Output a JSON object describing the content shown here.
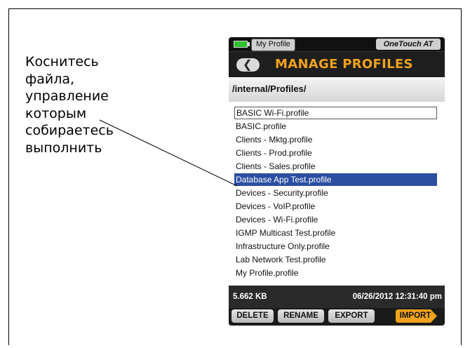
{
  "caption": {
    "lines": [
      "Коснитесь",
      "файла,",
      "управление",
      "которым",
      "собираетесь",
      "выполнить"
    ]
  },
  "device": {
    "status": {
      "profile_tab": "My Profile",
      "device_name": "OneTouch AT",
      "battery_color": "#2fbf2f"
    },
    "header": {
      "back_icon": "back-arrow-icon",
      "title": "MANAGE PROFILES",
      "title_color": "#f0a21c"
    },
    "path": "/internal/Profiles/",
    "files": [
      "BASIC Wi-Fi.profile",
      "BASIC.profile",
      "Clients - Mktg.profile",
      "Clients - Prod.profile",
      "Clients - Sales.profile",
      "Database App Test.profile",
      "Devices - Security.profile",
      "Devices - VoIP.profile",
      "Devices - Wi-Fi.profile",
      "IGMP Multicast Test.profile",
      "Infrastructure Only.profile",
      "Lab Network Test.profile",
      "My Profile.profile"
    ],
    "selected_file": "Database App Test.profile",
    "selection_color": "#2b4ea0",
    "info": {
      "size": "5.662 KB",
      "timestamp": "06/26/2012 12:31:40 pm"
    },
    "buttons": {
      "delete": "DELETE",
      "rename": "RENAME",
      "export": "EXPORT",
      "import": "IMPORT",
      "import_color": "#f0a21c"
    }
  }
}
